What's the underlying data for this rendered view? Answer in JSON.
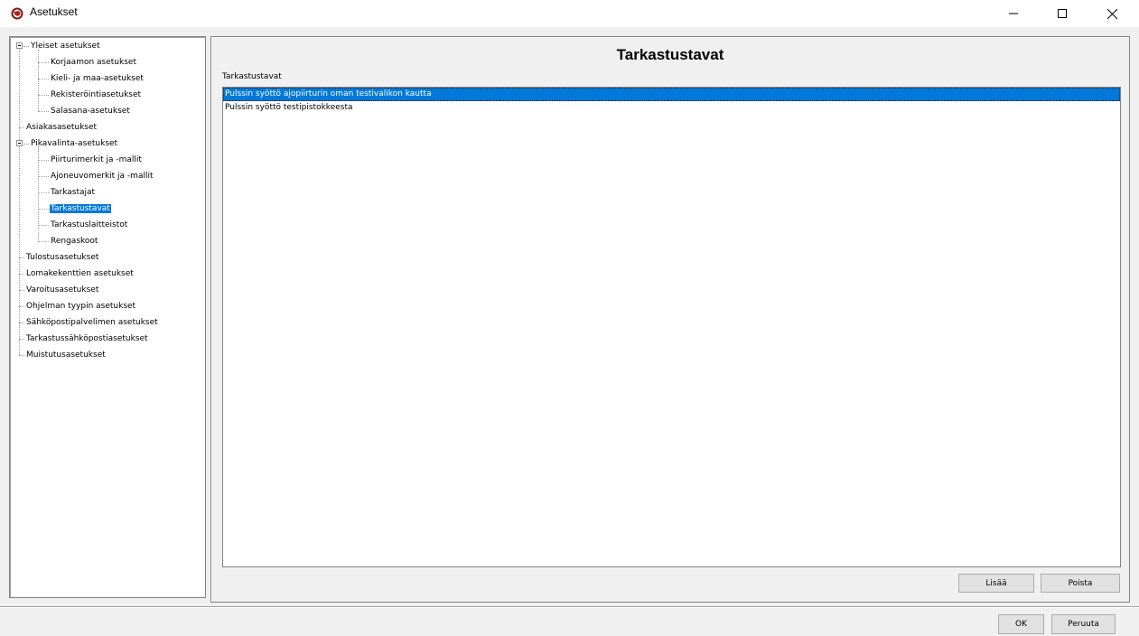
{
  "window": {
    "title": "Asetukset",
    "icon": "app-logo-icon",
    "controls": [
      "minimize-icon",
      "maximize-icon",
      "close-icon"
    ]
  },
  "tree": {
    "items": [
      {
        "label": "Yleiset asetukset",
        "level": 0,
        "expander": "minus",
        "selected": false
      },
      {
        "label": "Korjaamon asetukset",
        "level": 1,
        "selected": false
      },
      {
        "label": "Kieli- ja maa-asetukset",
        "level": 1,
        "selected": false
      },
      {
        "label": "Rekisteröintiasetukset",
        "level": 1,
        "selected": false
      },
      {
        "label": "Salasana-asetukset",
        "level": 1,
        "selected": false
      },
      {
        "label": "Asiakasasetukset",
        "level": 0,
        "selected": false
      },
      {
        "label": "Pikavalinta-asetukset",
        "level": 0,
        "expander": "minus",
        "selected": false
      },
      {
        "label": "Piirturimerkit ja -mallit",
        "level": 1,
        "selected": false
      },
      {
        "label": "Ajoneuvomerkit ja -mallit",
        "level": 1,
        "selected": false
      },
      {
        "label": "Tarkastajat",
        "level": 1,
        "selected": false
      },
      {
        "label": "Tarkastustavat",
        "level": 1,
        "selected": true
      },
      {
        "label": "Tarkastuslaitteistot",
        "level": 1,
        "selected": false
      },
      {
        "label": "Rengaskoot",
        "level": 1,
        "selected": false
      },
      {
        "label": "Tulostusasetukset",
        "level": 0,
        "selected": false
      },
      {
        "label": "Lomakekenttien asetukset",
        "level": 0,
        "selected": false
      },
      {
        "label": "Varoitusasetukset",
        "level": 0,
        "selected": false
      },
      {
        "label": "Ohjelman tyypin asetukset",
        "level": 0,
        "selected": false
      },
      {
        "label": "Sähköpostipalvelimen asetukset",
        "level": 0,
        "selected": false
      },
      {
        "label": "Tarkastussähköpostiasetukset",
        "level": 0,
        "selected": false
      },
      {
        "label": "Muistutusasetukset",
        "level": 0,
        "selected": false
      }
    ]
  },
  "content": {
    "title": "Tarkastustavat",
    "list_label": "Tarkastustavat",
    "list_items": [
      {
        "label": "Pulssin syöttö ajopiirturin oman testivalikon kautta",
        "selected": true
      },
      {
        "label": "Pulssin syöttö testipistokkeesta",
        "selected": false
      }
    ],
    "add_label": "Lisää",
    "remove_label": "Poista"
  },
  "footer": {
    "ok_label": "OK",
    "cancel_label": "Peruuta"
  },
  "colors": {
    "selection": "#0078d7",
    "window_bg": "#f0f0f0",
    "button_bg": "#e1e1e1"
  }
}
